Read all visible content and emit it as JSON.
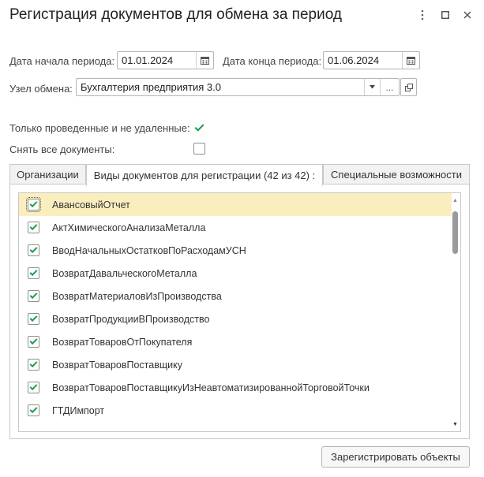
{
  "window": {
    "title": "Регистрация документов для обмена за период",
    "menu_icon": "kebab-menu-icon",
    "maximize_icon": "maximize-icon",
    "close_icon": "close-icon"
  },
  "period": {
    "start_label": "Дата начала периода:",
    "start_value": "01.01.2024",
    "end_label": "Дата конца периода:",
    "end_value": "01.06.2024",
    "calendar_icon": "calendar-icon"
  },
  "node": {
    "label": "Узел обмена:",
    "value": "Бухгалтерия предприятия 3.0",
    "select_button": "...",
    "dropdown_icon": "dropdown-arrow-icon",
    "open_icon": "open-link-icon"
  },
  "options": {
    "only_posted_label": "Только проведенные и не удаленные:",
    "only_posted_checked": true,
    "uncheck_all_label": "Снять все документы:",
    "uncheck_all_checked": false
  },
  "tabs": [
    {
      "label": "Организации",
      "active": false
    },
    {
      "label": "Виды документов для регистрации (42 из 42) :",
      "active": true
    },
    {
      "label": "Специальные возможности",
      "active": false
    }
  ],
  "document_types": [
    {
      "label": "АвансовыйОтчет",
      "checked": true,
      "selected": true
    },
    {
      "label": "АктХимическогоАнализаМеталла",
      "checked": true
    },
    {
      "label": "ВводНачальныхОстатковПоРасходамУСН",
      "checked": true
    },
    {
      "label": "ВозвратДавальческогоМеталла",
      "checked": true
    },
    {
      "label": "ВозвратМатериаловИзПроизводства",
      "checked": true
    },
    {
      "label": "ВозвратПродукцииВПроизводство",
      "checked": true
    },
    {
      "label": "ВозвратТоваровОтПокупателя",
      "checked": true
    },
    {
      "label": "ВозвратТоваровПоставщику",
      "checked": true
    },
    {
      "label": "ВозвратТоваровПоставщикуИзНеавтоматизированнойТорговойТочки",
      "checked": true
    },
    {
      "label": "ГТДИмпорт",
      "checked": true
    }
  ],
  "footer": {
    "register_button": "Зарегистрировать объекты"
  }
}
